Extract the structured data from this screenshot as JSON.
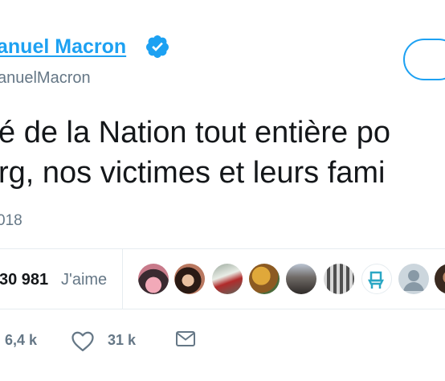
{
  "header": {
    "display_name": "anuel Macron",
    "handle": "anuelMacron"
  },
  "tweet": {
    "line1": "é de la Nation tout entière po",
    "line2": "rg, nos victimes et leurs fami",
    "date": "018"
  },
  "stats": {
    "likes_count": "30 981",
    "likes_label": "J'aime",
    "avatars": [
      "avatar-1",
      "avatar-2",
      "avatar-3",
      "avatar-4",
      "avatar-5",
      "avatar-6",
      "avatar-7",
      "avatar-8",
      "avatar-9"
    ]
  },
  "actions": {
    "retweets": "6,4 k",
    "likes": "31 k"
  },
  "colors": {
    "accent": "#1da1f2",
    "secondary_text": "#657786",
    "divider": "#e6ecf0"
  },
  "icons": [
    "verified-badge-icon",
    "heart-icon",
    "message-icon"
  ]
}
